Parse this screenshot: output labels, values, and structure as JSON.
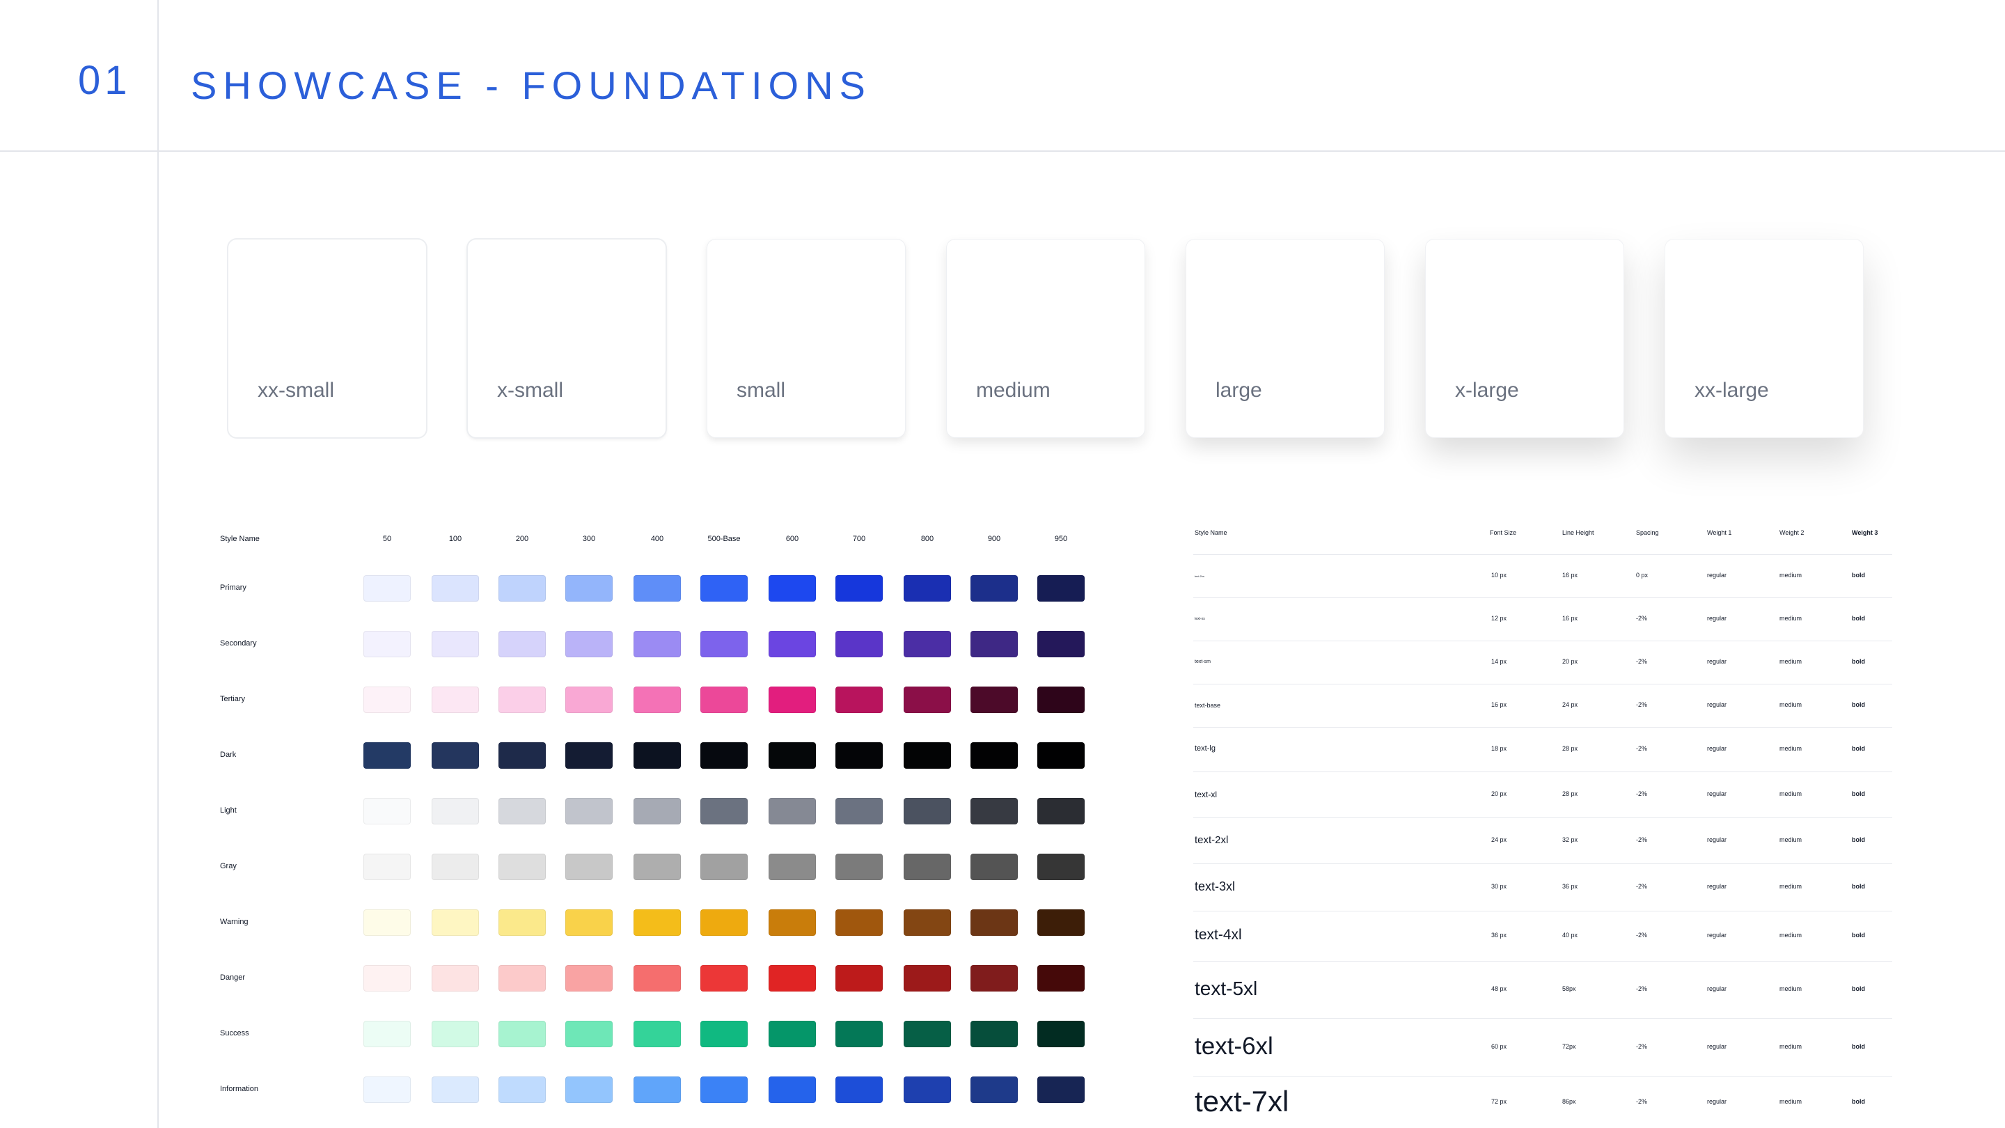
{
  "header": {
    "section_number": "01",
    "title": "SHOWCASE - FOUNDATIONS"
  },
  "shadows": {
    "cards": [
      "xx-small",
      "x-small",
      "small",
      "medium",
      "large",
      "x-large",
      "xx-large"
    ]
  },
  "palette": {
    "style_name_header": "Style Name",
    "shades": [
      "50",
      "100",
      "200",
      "300",
      "400",
      "500-Base",
      "600",
      "700",
      "800",
      "900",
      "950"
    ],
    "rows": [
      {
        "name": "Primary",
        "colors": [
          "#eef2ff",
          "#dbe4fe",
          "#bfd3fd",
          "#93b5fb",
          "#5f8ef8",
          "#2f62f5",
          "#1d48ef",
          "#1637dc",
          "#1a2fb2",
          "#1c2f8b",
          "#161d54"
        ]
      },
      {
        "name": "Secondary",
        "colors": [
          "#f3f2fe",
          "#e9e7fd",
          "#d6d3fb",
          "#bab3f8",
          "#9b8bf3",
          "#7d63ec",
          "#6b45e1",
          "#5a35c8",
          "#4b2ea5",
          "#3e2885",
          "#24185a"
        ]
      },
      {
        "name": "Tertiary",
        "colors": [
          "#fdf2f8",
          "#fce7f3",
          "#fbcfe8",
          "#f9a8d4",
          "#f472b6",
          "#ec4899",
          "#e21e7e",
          "#b8145d",
          "#8b0f48",
          "#4c0a29",
          "#2e051a"
        ]
      },
      {
        "name": "Dark",
        "colors": [
          "#233a65",
          "#24365e",
          "#1e2a4a",
          "#141c33",
          "#0c1220",
          "#06090f",
          "#050709",
          "#040507",
          "#030405",
          "#020203",
          "#010102"
        ]
      },
      {
        "name": "Light",
        "colors": [
          "#f9fafb",
          "#f0f1f3",
          "#d6d8dd",
          "#c1c4cc",
          "#a6aab4",
          "#6b7280",
          "#858994",
          "#6b7281",
          "#4b5260",
          "#373a42",
          "#2b2d33"
        ]
      },
      {
        "name": "Gray",
        "colors": [
          "#f5f5f5",
          "#ececec",
          "#dedede",
          "#c8c8c8",
          "#aeaeae",
          "#a1a1a1",
          "#8b8b8b",
          "#7b7b7b",
          "#676767",
          "#545454",
          "#363636"
        ]
      },
      {
        "name": "Warning",
        "colors": [
          "#fefce8",
          "#fef6c2",
          "#fbe98b",
          "#f9d24a",
          "#f4bd1a",
          "#eeaa0f",
          "#c97d0b",
          "#a0570d",
          "#834613",
          "#6c3615",
          "#3d1e08"
        ]
      },
      {
        "name": "Danger",
        "colors": [
          "#fef2f2",
          "#fde3e3",
          "#fccaca",
          "#f9a3a3",
          "#f56e6e",
          "#ec3737",
          "#e02424",
          "#bd1b1b",
          "#9c1a1a",
          "#801c1c",
          "#450909"
        ]
      },
      {
        "name": "Success",
        "colors": [
          "#ecfdf5",
          "#d1fae5",
          "#a7f3d0",
          "#6ee7b7",
          "#34d399",
          "#10b981",
          "#059669",
          "#047857",
          "#065f46",
          "#064e3b",
          "#022c22"
        ]
      },
      {
        "name": "Information",
        "colors": [
          "#eff6ff",
          "#dbeafe",
          "#bfdbfe",
          "#93c5fd",
          "#60a5fa",
          "#3b82f6",
          "#2563eb",
          "#1d4ed8",
          "#1e40af",
          "#1e3a8a",
          "#172554"
        ]
      }
    ]
  },
  "typography": {
    "headers": {
      "style_name": "Style Name",
      "font_size": "Font Size",
      "line_height": "Line Height",
      "spacing": "Spacing",
      "weight1": "Weight 1",
      "weight2": "Weight 2",
      "weight3": "Weight 3"
    },
    "rows": [
      {
        "name": "text-2xs",
        "font_size": "10 px",
        "line_height": "16 px",
        "spacing": "0 px",
        "weight1": "regular",
        "weight2": "medium",
        "weight3": "bold"
      },
      {
        "name": "text-xs",
        "font_size": "12 px",
        "line_height": "16 px",
        "spacing": "-2%",
        "weight1": "regular",
        "weight2": "medium",
        "weight3": "bold"
      },
      {
        "name": "text-sm",
        "font_size": "14 px",
        "line_height": "20 px",
        "spacing": "-2%",
        "weight1": "regular",
        "weight2": "medium",
        "weight3": "bold"
      },
      {
        "name": "text-base",
        "font_size": "16 px",
        "line_height": "24 px",
        "spacing": "-2%",
        "weight1": "regular",
        "weight2": "medium",
        "weight3": "bold"
      },
      {
        "name": "text-lg",
        "font_size": "18 px",
        "line_height": "28 px",
        "spacing": "-2%",
        "weight1": "regular",
        "weight2": "medium",
        "weight3": "bold"
      },
      {
        "name": "text-xl",
        "font_size": "20 px",
        "line_height": "28 px",
        "spacing": "-2%",
        "weight1": "regular",
        "weight2": "medium",
        "weight3": "bold"
      },
      {
        "name": "text-2xl",
        "font_size": "24 px",
        "line_height": "32 px",
        "spacing": "-2%",
        "weight1": "regular",
        "weight2": "medium",
        "weight3": "bold"
      },
      {
        "name": "text-3xl",
        "font_size": "30 px",
        "line_height": "36 px",
        "spacing": "-2%",
        "weight1": "regular",
        "weight2": "medium",
        "weight3": "bold"
      },
      {
        "name": "text-4xl",
        "font_size": "36 px",
        "line_height": "40 px",
        "spacing": "-2%",
        "weight1": "regular",
        "weight2": "medium",
        "weight3": "bold"
      },
      {
        "name": "text-5xl",
        "font_size": "48 px",
        "line_height": "58px",
        "spacing": "-2%",
        "weight1": "regular",
        "weight2": "medium",
        "weight3": "bold"
      },
      {
        "name": "text-6xl",
        "font_size": "60 px",
        "line_height": "72px",
        "spacing": "-2%",
        "weight1": "regular",
        "weight2": "medium",
        "weight3": "bold"
      },
      {
        "name": "text-7xl",
        "font_size": "72 px",
        "line_height": "86px",
        "spacing": "-2%",
        "weight1": "regular",
        "weight2": "medium",
        "weight3": "bold"
      }
    ]
  }
}
